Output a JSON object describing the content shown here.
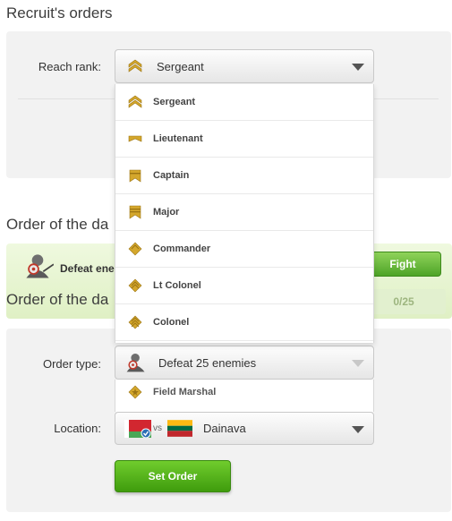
{
  "recruit": {
    "title": "Recruit's orders",
    "reach_rank_label": "Reach rank:",
    "selected_rank": "Sergeant",
    "rank_options": [
      "Sergeant",
      "Lieutenant",
      "Captain",
      "Major",
      "Commander",
      "Lt Colonel",
      "Colonel",
      "Field Marshal"
    ]
  },
  "daily": {
    "title": "Order of the day",
    "title_visible": "Order of the da",
    "mission_text": "Defeat enemies",
    "mission_visible": "Defeat ene",
    "fight_label": "Fight",
    "progress_text": "0/25"
  },
  "order_form": {
    "title_visible": "Order of the da",
    "order_type_label": "Order type:",
    "order_type_value": "Defeat 25 enemies",
    "location_label": "Location:",
    "location_vs": "vs",
    "location_value": "Dainava",
    "set_order_label": "Set Order"
  },
  "colors": {
    "rank_gold": "#d4a72c",
    "fight_green": "#5ab030",
    "set_order_green": "#52ad17",
    "progress_text": "#9db57f"
  }
}
